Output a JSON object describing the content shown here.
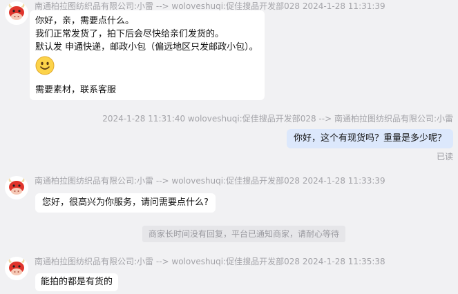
{
  "messages": {
    "m1": {
      "meta": "南通柏拉图纺织品有限公司:小雷 --> woloveshuqi:促佳搜品开发部028   2024-1-28 11:31:39",
      "lines": [
        "你好，亲，需要点什么。",
        "我们正常发货了，拍下后会尽快给亲们发货的。",
        "默认发 申通快递，邮政小包（偏远地区只发邮政小包）。"
      ],
      "emoji": "smile-emoji",
      "tail": "需要素材，联系客服"
    },
    "m2": {
      "meta": "2024-1-28 11:31:40   woloveshuqi:促佳搜品开发部028 --> 南通柏拉图纺织品有限公司:小雷",
      "text": "你好，这个有现货吗？重量是多少呢？",
      "status": "已读"
    },
    "m3": {
      "meta": "南通柏拉图纺织品有限公司:小雷 --> woloveshuqi:促佳搜品开发部028   2024-1-28 11:33:39",
      "text": "您好，很高兴为你服务，请问需要点什么?"
    },
    "system_note": "商家长时间没有回复，平台已通知商家，请耐心等待",
    "m4": {
      "meta": "南通柏拉图纺织品有限公司:小雷 --> woloveshuqi:促佳搜品开发部028   2024-1-28 11:35:38",
      "text": "能拍的都是有货的"
    }
  },
  "colors": {
    "background": "#f1f1f3",
    "bubble_in": "#ffffff",
    "bubble_out": "#dce8fc",
    "avatar_red": "#e0342b"
  }
}
